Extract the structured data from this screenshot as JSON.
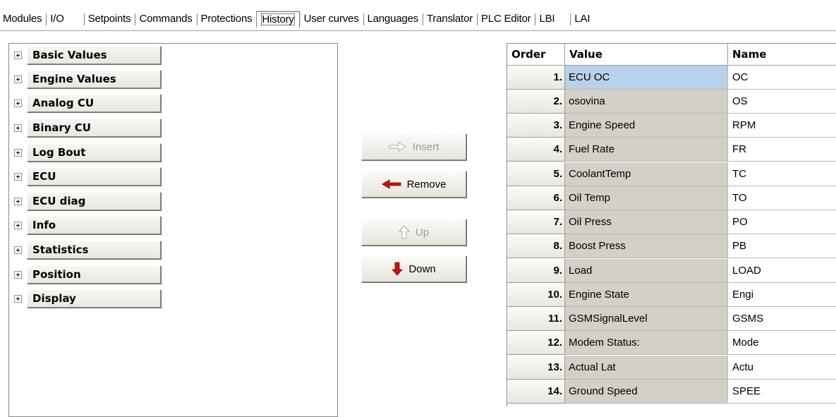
{
  "tabs": [
    {
      "label": "Modules",
      "active": false
    },
    {
      "label": "I/O",
      "active": false
    },
    {
      "label": "Setpoints",
      "active": false
    },
    {
      "label": "Commands",
      "active": false
    },
    {
      "label": "Protections",
      "active": false
    },
    {
      "label": "History",
      "active": true
    },
    {
      "label": "User curves",
      "active": false
    },
    {
      "label": "Languages",
      "active": false
    },
    {
      "label": "Translator",
      "active": false
    },
    {
      "label": "PLC Editor",
      "active": false
    },
    {
      "label": "LBI",
      "active": false
    },
    {
      "label": "LAI",
      "active": false
    }
  ],
  "tree": {
    "groups": [
      {
        "label": "Basic Values",
        "icon": "expand-plus-icon"
      },
      {
        "label": "Engine Values",
        "icon": "expand-plus-icon"
      },
      {
        "label": "Analog CU",
        "icon": "expand-plus-icon"
      },
      {
        "label": "Binary CU",
        "icon": "expand-plus-icon"
      },
      {
        "label": "Log Bout",
        "icon": "expand-plus-icon"
      },
      {
        "label": "ECU",
        "icon": "expand-plus-icon"
      },
      {
        "label": "ECU diag",
        "icon": "expand-plus-icon"
      },
      {
        "label": "Info",
        "icon": "expand-plus-icon"
      },
      {
        "label": "Statistics",
        "icon": "expand-plus-icon"
      },
      {
        "label": "Position",
        "icon": "expand-plus-icon"
      },
      {
        "label": "Display",
        "icon": "expand-plus-icon"
      }
    ]
  },
  "actions": {
    "insert": {
      "label": "Insert",
      "enabled": false,
      "icon": "arrow-right-icon"
    },
    "remove": {
      "label": "Remove",
      "enabled": true,
      "icon": "arrow-left-icon"
    },
    "up": {
      "label": "Up",
      "enabled": false,
      "icon": "arrow-up-icon"
    },
    "down": {
      "label": "Down",
      "enabled": true,
      "icon": "arrow-down-icon"
    }
  },
  "grid": {
    "headers": {
      "order": "Order",
      "value": "Value",
      "name": "Name"
    },
    "rows": [
      {
        "order": "1.",
        "value": "ECU OC",
        "name": "OC",
        "selected": true
      },
      {
        "order": "2.",
        "value": "osovina",
        "name": "OS"
      },
      {
        "order": "3.",
        "value": "Engine Speed",
        "name": "RPM"
      },
      {
        "order": "4.",
        "value": "Fuel Rate",
        "name": "FR"
      },
      {
        "order": "5.",
        "value": "CoolantTemp",
        "name": "TC"
      },
      {
        "order": "6.",
        "value": "Oil Temp",
        "name": "TO"
      },
      {
        "order": "7.",
        "value": "Oil Press",
        "name": "PO"
      },
      {
        "order": "8.",
        "value": "Boost Press",
        "name": "PB"
      },
      {
        "order": "9.",
        "value": "Load",
        "name": "LOAD"
      },
      {
        "order": "10.",
        "value": "Engine State",
        "name": "Engi"
      },
      {
        "order": "11.",
        "value": "GSMSignalLevel",
        "name": "GSMS"
      },
      {
        "order": "12.",
        "value": "Modem Status:",
        "name": "Mode"
      },
      {
        "order": "13.",
        "value": "Actual Lat",
        "name": "Actu"
      },
      {
        "order": "14.",
        "value": "Ground Speed",
        "name": "SPEE"
      }
    ]
  },
  "colors": {
    "selected_row": "#b9d1ea",
    "value_cell": "#d4d0c8",
    "remove_arrow": "#cc1111",
    "down_arrow": "#cc1111"
  }
}
